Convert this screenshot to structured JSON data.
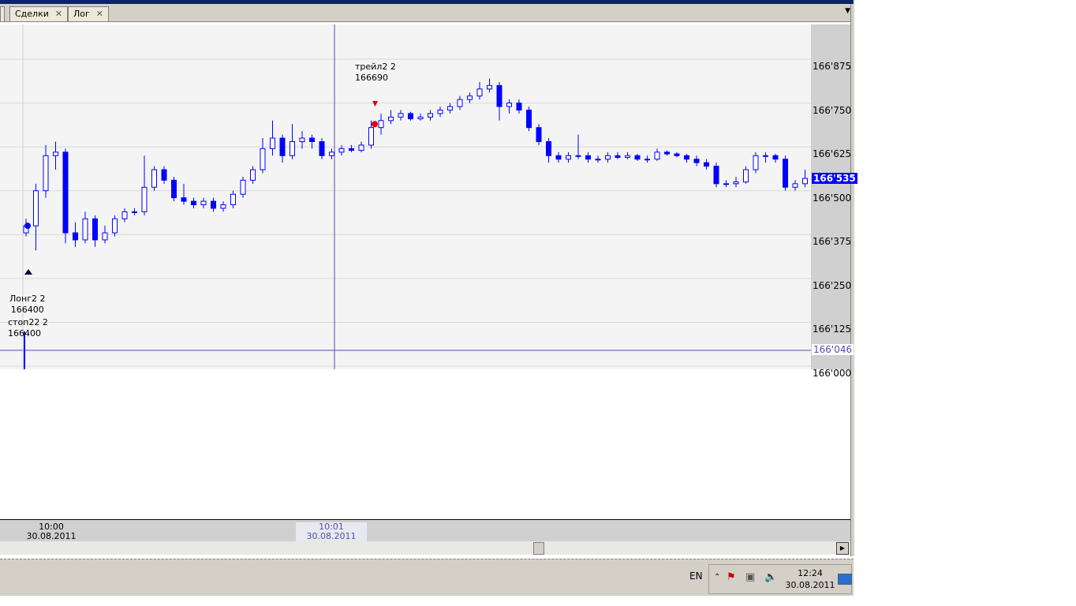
{
  "tabs": [
    {
      "label": "Сделки"
    },
    {
      "label": "Лог"
    }
  ],
  "price_axis": {
    "ticks": [
      "166'875",
      "166'750",
      "166'625",
      "166'500",
      "166'375",
      "166'250",
      "166'125",
      "166'000"
    ],
    "current": "166'535",
    "line": "166'046"
  },
  "time_axis": [
    {
      "time": "10:00",
      "date": "30.08.2011"
    },
    {
      "time": "10:01",
      "date": "30.08.2011"
    }
  ],
  "annotations": {
    "long": {
      "name": "Лонг2 2",
      "price": "166400"
    },
    "stop": {
      "name": "стоп22 2",
      "price": "166400"
    },
    "trail": {
      "name": "трейл2 2",
      "price": "166690"
    }
  },
  "taskbar": {
    "lang": "EN",
    "time": "12:24",
    "date": "30.08.2011"
  },
  "colors": {
    "candle": "#0000ff",
    "current_bg": "#0000ff",
    "line": "#5050b0"
  },
  "chart_data": {
    "type": "candlestick",
    "ylim": [
      166000,
      166930
    ],
    "ohlc": [
      [
        166380,
        166420,
        166370,
        166400
      ],
      [
        166400,
        166520,
        166330,
        166500
      ],
      [
        166500,
        166630,
        166480,
        166600
      ],
      [
        166600,
        166640,
        166560,
        166610
      ],
      [
        166610,
        166620,
        166350,
        166380
      ],
      [
        166380,
        166410,
        166340,
        166360
      ],
      [
        166360,
        166440,
        166350,
        166420
      ],
      [
        166420,
        166430,
        166340,
        166360
      ],
      [
        166360,
        166400,
        166350,
        166380
      ],
      [
        166380,
        166430,
        166370,
        166420
      ],
      [
        166420,
        166450,
        166410,
        166440
      ],
      [
        166440,
        166450,
        166430,
        166440
      ],
      [
        166440,
        166600,
        166430,
        166510
      ],
      [
        166510,
        166570,
        166500,
        166560
      ],
      [
        166560,
        166570,
        166520,
        166530
      ],
      [
        166530,
        166540,
        166470,
        166480
      ],
      [
        166480,
        166520,
        166460,
        166470
      ],
      [
        166470,
        166480,
        166450,
        166460
      ],
      [
        166460,
        166480,
        166450,
        166470
      ],
      [
        166470,
        166480,
        166440,
        166450
      ],
      [
        166450,
        166470,
        166440,
        166460
      ],
      [
        166460,
        166500,
        166450,
        166490
      ],
      [
        166490,
        166540,
        166480,
        166530
      ],
      [
        166530,
        166570,
        166520,
        166560
      ],
      [
        166560,
        166650,
        166550,
        166620
      ],
      [
        166620,
        166700,
        166600,
        166650
      ],
      [
        166650,
        166660,
        166580,
        166600
      ],
      [
        166600,
        166690,
        166590,
        166640
      ],
      [
        166640,
        166670,
        166620,
        166650
      ],
      [
        166650,
        166660,
        166620,
        166640
      ],
      [
        166640,
        166650,
        166590,
        166600
      ],
      [
        166600,
        166620,
        166590,
        166610
      ],
      [
        166610,
        166630,
        166600,
        166620
      ],
      [
        166620,
        166630,
        166610,
        166615
      ],
      [
        166615,
        166640,
        166610,
        166630
      ],
      [
        166630,
        166700,
        166620,
        166680
      ],
      [
        166680,
        166720,
        166660,
        166700
      ],
      [
        166700,
        166730,
        166690,
        166710
      ],
      [
        166710,
        166730,
        166700,
        166720
      ],
      [
        166720,
        166725,
        166700,
        166705
      ],
      [
        166705,
        166720,
        166700,
        166710
      ],
      [
        166710,
        166730,
        166700,
        166720
      ],
      [
        166720,
        166740,
        166710,
        166730
      ],
      [
        166730,
        166750,
        166720,
        166740
      ],
      [
        166740,
        166770,
        166730,
        166760
      ],
      [
        166760,
        166780,
        166750,
        166770
      ],
      [
        166770,
        166810,
        166760,
        166790
      ],
      [
        166790,
        166820,
        166780,
        166800
      ],
      [
        166800,
        166810,
        166700,
        166740
      ],
      [
        166740,
        166760,
        166720,
        166750
      ],
      [
        166750,
        166760,
        166720,
        166730
      ],
      [
        166730,
        166740,
        166670,
        166680
      ],
      [
        166680,
        166690,
        166630,
        166640
      ],
      [
        166640,
        166650,
        166580,
        166600
      ],
      [
        166600,
        166610,
        166580,
        166590
      ],
      [
        166590,
        166610,
        166580,
        166600
      ],
      [
        166600,
        166660,
        166590,
        166600
      ],
      [
        166600,
        166610,
        166580,
        166590
      ],
      [
        166590,
        166600,
        166580,
        166590
      ],
      [
        166590,
        166610,
        166580,
        166600
      ],
      [
        166600,
        166610,
        166590,
        166595
      ],
      [
        166595,
        166610,
        166590,
        166600
      ],
      [
        166600,
        166605,
        166585,
        166590
      ],
      [
        166590,
        166600,
        166580,
        166590
      ],
      [
        166590,
        166620,
        166585,
        166610
      ],
      [
        166610,
        166615,
        166600,
        166605
      ],
      [
        166605,
        166610,
        166595,
        166600
      ],
      [
        166600,
        166605,
        166580,
        166590
      ],
      [
        166590,
        166600,
        166570,
        166580
      ],
      [
        166580,
        166590,
        166560,
        166570
      ],
      [
        166570,
        166580,
        166510,
        166520
      ],
      [
        166520,
        166530,
        166510,
        166520
      ],
      [
        166520,
        166540,
        166510,
        166525
      ],
      [
        166525,
        166570,
        166520,
        166560
      ],
      [
        166560,
        166610,
        166550,
        166600
      ],
      [
        166600,
        166610,
        166580,
        166600
      ],
      [
        166600,
        166605,
        166580,
        166590
      ],
      [
        166590,
        166600,
        166500,
        166510
      ],
      [
        166510,
        166530,
        166500,
        166520
      ],
      [
        166520,
        166560,
        166510,
        166535
      ]
    ]
  }
}
